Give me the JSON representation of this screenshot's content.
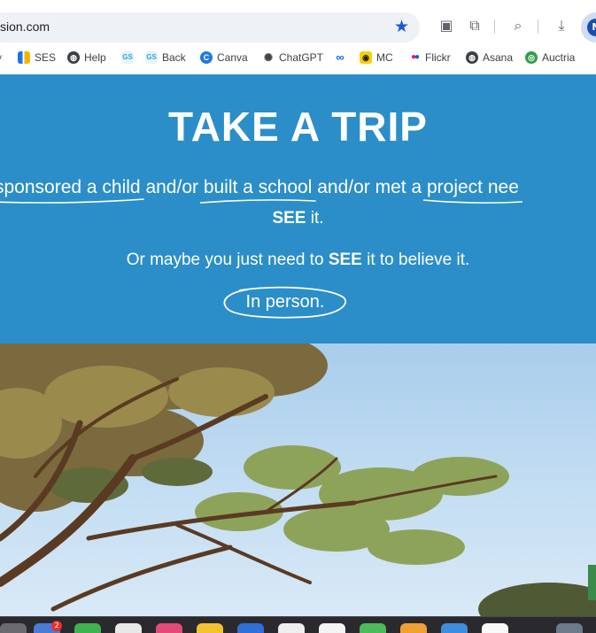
{
  "browser": {
    "url": "sion.com",
    "bookmarks": [
      {
        "label": "",
        "icon": "partial-icon",
        "color": "#777777"
      },
      {
        "label": "SES",
        "icon": "ses-bars-icon",
        "color": "#1a73e8"
      },
      {
        "label": "Help",
        "icon": "globe-icon",
        "color": "#3c4043"
      },
      {
        "label": "",
        "icon": "gs-icon",
        "color": "#2aa7d6"
      },
      {
        "label": "Back",
        "icon": "gs-icon",
        "color": "#2aa7d6"
      },
      {
        "label": "Canva",
        "icon": "canva-icon",
        "color": "#1f7ae0"
      },
      {
        "label": "ChatGPT",
        "icon": "chatgpt-icon",
        "color": "#555555"
      },
      {
        "label": "",
        "icon": "meta-icon",
        "color": "#0866ff"
      },
      {
        "label": "MC",
        "icon": "mailchimp-icon",
        "color": "#f5d000"
      },
      {
        "label": "Flickr",
        "icon": "flickr-icon",
        "color": "#ff0084"
      },
      {
        "label": "Asana",
        "icon": "globe-icon",
        "color": "#3c4043"
      },
      {
        "label": "Auctria",
        "icon": "auctria-icon",
        "color": "#2e9d4a"
      }
    ],
    "profile_initial": "N"
  },
  "hero": {
    "title": "TAKE A TRIP",
    "line1_link1": "sponsored a child",
    "line1_connector1": " and/or ",
    "line1_link2": "built a school",
    "line1_connector2": " and/or met a ",
    "line1_link3": "project nee",
    "line2_bold": "SEE",
    "line2_rest": " it.",
    "line3_start": "Or maybe you just need to ",
    "line3_bold": "SEE",
    "line3_end": " it to believe it.",
    "cta": "In person.",
    "background_color": "#2b8ec9"
  },
  "photo": {
    "icon": "tree-photo"
  },
  "dock": {
    "badge_count": "2"
  }
}
